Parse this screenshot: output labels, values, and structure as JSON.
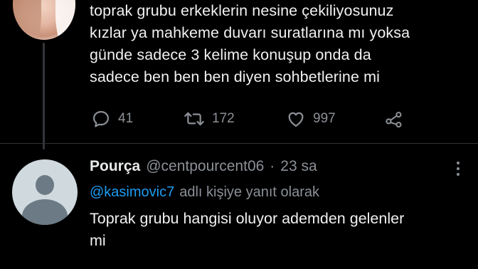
{
  "parent_tweet": {
    "text_lines": [
      "toprak grubu erkeklerin nesine çekiliyosunuz",
      "kızlar ya mahkeme duvarı suratlarına mı yoksa",
      "günde sadece 3 kelime konuşup onda da",
      "sadece ben ben ben diyen sohbetlerine mi"
    ],
    "actions": {
      "reply_count": "41",
      "retweet_count": "172",
      "like_count": "997"
    }
  },
  "reply_tweet": {
    "display_name": "Pourça",
    "handle": "@centpourcent06",
    "separator": "·",
    "time": "23 sa",
    "reply_to_handle": "@kasimovic7",
    "reply_to_suffix": "adlı kişiye yanıt olarak",
    "text_lines": [
      "Toprak grubu hangisi oluyor ademden gelenler",
      "mi"
    ]
  },
  "icons": {
    "reply": "reply-icon",
    "retweet": "retweet-icon",
    "like": "heart-icon",
    "share": "share-icon",
    "more": "more-options-icon"
  },
  "colors": {
    "background": "#000000",
    "text": "#e7e9ea",
    "muted": "#8b9096",
    "link": "#1d9bf0",
    "divider": "#2f3336"
  }
}
